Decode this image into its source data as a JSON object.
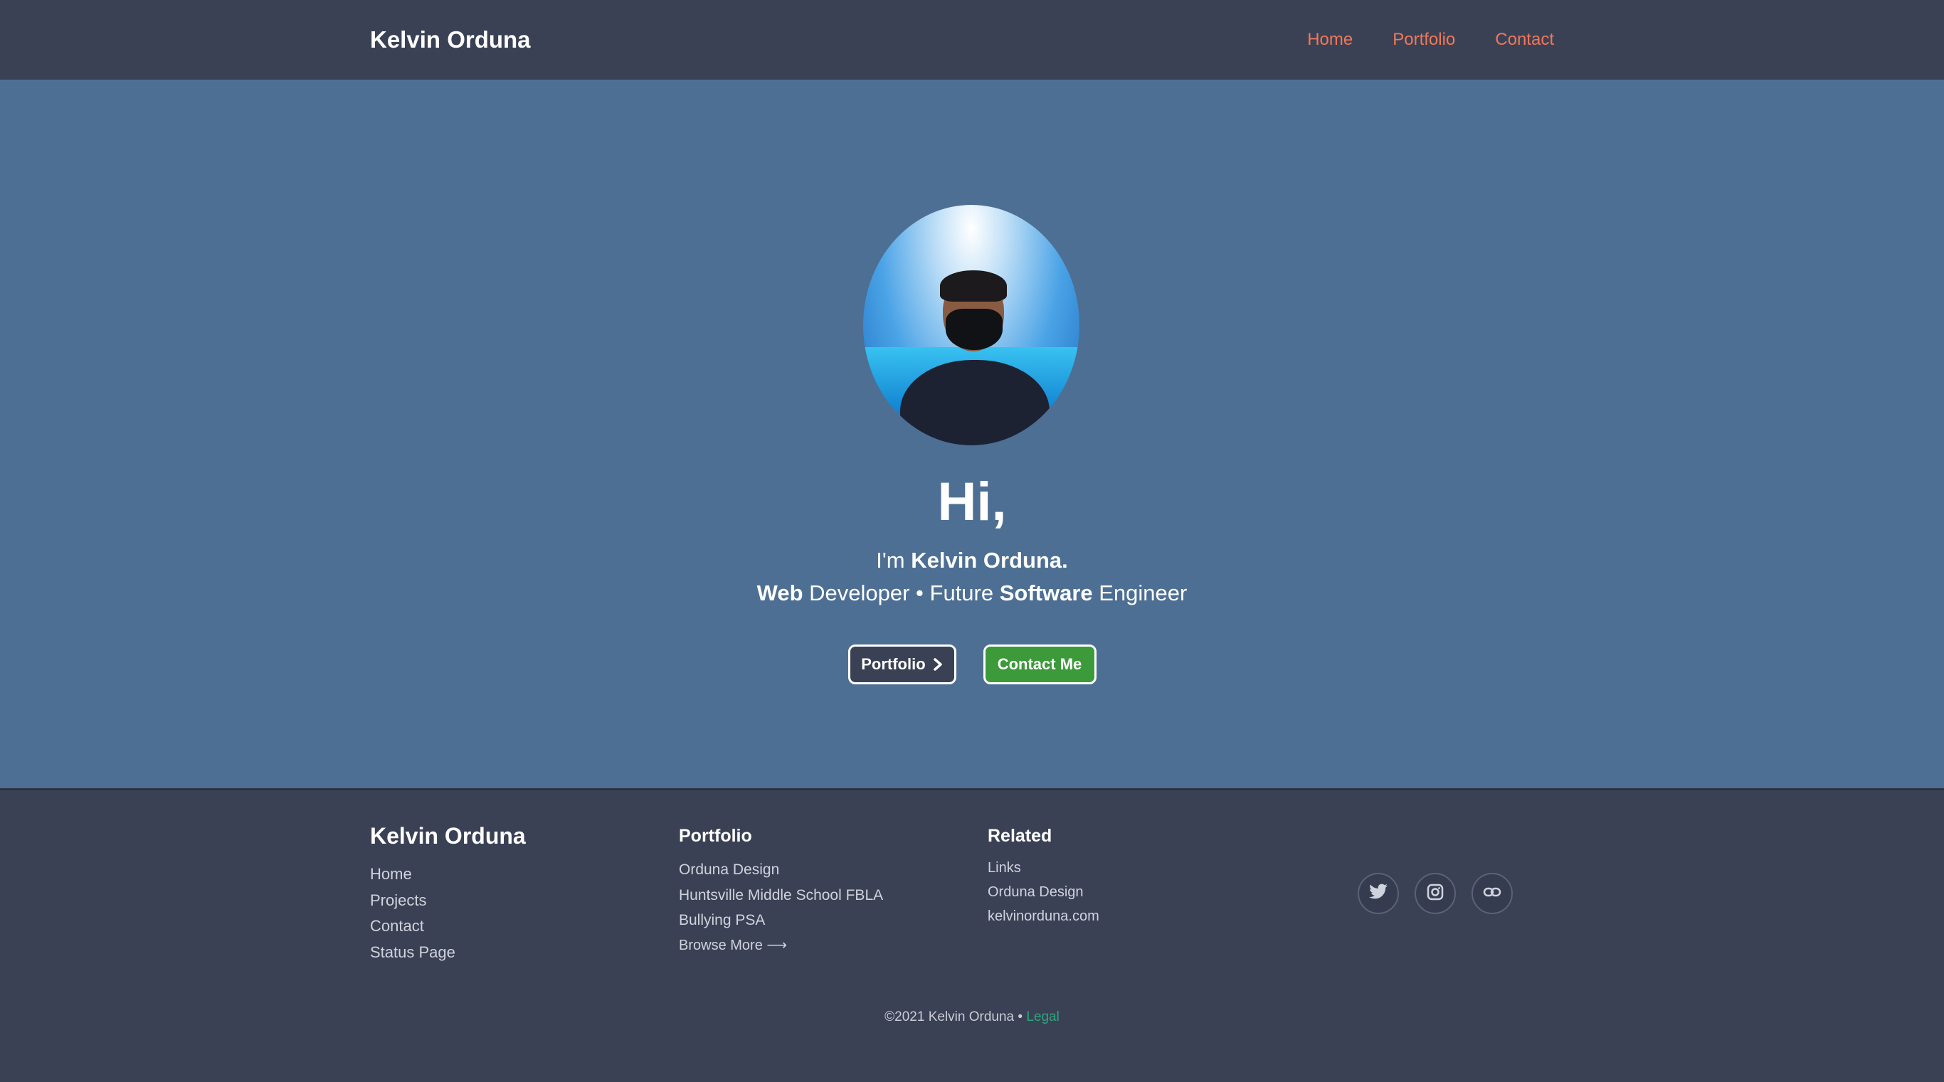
{
  "header": {
    "brand": "Kelvin Orduna",
    "nav": [
      {
        "label": "Home"
      },
      {
        "label": "Portfolio"
      },
      {
        "label": "Contact"
      }
    ]
  },
  "colors": {
    "header_bg": "#3b4155",
    "hero_bg": "#4d6f93",
    "nav_link": "#f07857",
    "contact_button": "#3c9a3a",
    "legal_link": "#2aa87a"
  },
  "hero": {
    "greeting": "Hi,",
    "intro_prefix": "I'm",
    "intro_name": "Kelvin Orduna.",
    "tagline": [
      {
        "text": "Web",
        "bold": true
      },
      {
        "text": " Developer • Future ",
        "bold": false
      },
      {
        "text": "Software",
        "bold": true
      },
      {
        "text": " Engineer",
        "bold": false
      }
    ],
    "portfolio_button": "Portfolio",
    "portfolio_button_icon": "chevron-right-icon",
    "contact_button": "Contact Me"
  },
  "footer": {
    "brand": "Kelvin Orduna",
    "links": [
      "Home",
      "Projects",
      "Contact",
      "Status Page"
    ],
    "portfolio": {
      "heading": "Portfolio",
      "items": [
        "Orduna Design",
        "Huntsville Middle School FBLA",
        "Bullying PSA"
      ],
      "browse_more": "Browse More ⟶"
    },
    "related": {
      "heading": "Related",
      "items": [
        "Links",
        "Orduna Design",
        "kelvinorduna.com"
      ]
    },
    "socials": [
      "twitter-icon",
      "instagram-icon",
      "link-icon"
    ],
    "copyright": "©2021 Kelvin Orduna •",
    "legal": "Legal"
  }
}
